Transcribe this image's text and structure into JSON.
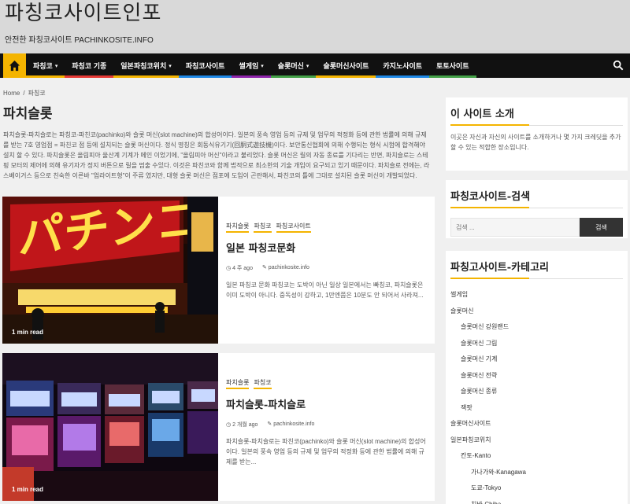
{
  "header": {
    "title": "파칭코사이트인포",
    "tagline": "안전한 파칭코사이트 PACHINKOSITE.INFO"
  },
  "nav": {
    "items": [
      {
        "label": "파칭코",
        "has_sub": true,
        "color": "#f4b400"
      },
      {
        "label": "파칭코 기종",
        "has_sub": false,
        "color": "#e53935"
      },
      {
        "label": "일본파칭코위치",
        "has_sub": true,
        "color": "#f4b400"
      },
      {
        "label": "파칭코사이트",
        "has_sub": false,
        "color": "#1e88e5"
      },
      {
        "label": "썰게임",
        "has_sub": true,
        "color": "#8e24aa"
      },
      {
        "label": "슬롯머신",
        "has_sub": true,
        "color": "#43a047"
      },
      {
        "label": "슬롯머신사이트",
        "has_sub": false,
        "color": "#f4b400"
      },
      {
        "label": "카지노사이트",
        "has_sub": false,
        "color": "#1e88e5"
      },
      {
        "label": "토토사이트",
        "has_sub": false,
        "color": "#43a047"
      }
    ],
    "home_icon": "home-icon",
    "search_icon": "search-icon"
  },
  "breadcrumb": [
    "Home",
    "파칭코"
  ],
  "page": {
    "title": "파치슬롯",
    "description": "파치슬롯-파치슬로는 파칭코-파친코(pachinko)와 슬롯 머신(slot machine)의 합성어이다. 일본의 풍속 영업 등의 규제 및 업무의 적정화 등에 관한 법률에 의해 규제를 받는 7호 영업점 = 파친코 점 등에 설치되는 슬롯 머신이다. 정식 명칭은 회동식유기기(回胴式遊技機)이다. 보안통신협회에 의해 수행되는 형식 시험에 합격해야 설치 할 수 있다. 파치슬롯은 올림피아 울산계 기계가 메인 이었기에, \"올림피아 머신\"이라고 불리었다. 슬롯 머신은 릴의 자동 종료를 기다리는 반면, 파치슬로는 스테핑 모터의 제어에 의해 유기자가 정지 버튼으로 릴을 멈출 수있다. 이것은 파친코와 함께 법적으로 최소한의 기술 개입이 요구되고 있기 때문이다. 파치슬로 전에는, 라스베이거스 등으로 친숙한 이른바 \"업라이트형\"이 주류 였지만, 대형 슬롯 머신은 점포에 도입이 곤란해서, 파친코의 틀에 그대로 설치된 슬롯 머신이 개발되었다."
  },
  "posts": [
    {
      "read_time": "1 min read",
      "categories": [
        "파치슬롯",
        "파칭코",
        "파칭코사이트"
      ],
      "title": "일본 파칭코문화",
      "date": "4 주 ago",
      "author": "pachinkosite.info",
      "excerpt": "일본 파칭코 문화 파칭코는 도박이 아닌 일상 일본에서는 빠칭코, 파치슬롯은 이미 도박이 아니다. 중독성이 강하고, 1만엔쯤은 10분도 안 되어서 사라져..."
    },
    {
      "read_time": "1 min read",
      "categories": [
        "파치슬롯",
        "파칭코"
      ],
      "title": "파치슬롯-파치슬로",
      "date": "2 개월 ago",
      "author": "pachinkosite.info",
      "excerpt": "파치슬롯-파치슬로는 파친코(pachinko)와 슬롯 머신(slot machine)의 합성어이다. 일본의 풍속 영업 등의 규제 및 업무의 적정화 등에 관한 법률에 의해 규제를 받는..."
    }
  ],
  "sidebar": {
    "about": {
      "title": "이 사이트 소개",
      "text": "이곳은 자신과 자신의 사이트를 소개하거나 몇 가지 크레딧을 추가할 수 있는 적합한 장소입니다."
    },
    "search": {
      "title": "파칭코사이트-검색",
      "placeholder": "검색 ...",
      "button": "검색"
    },
    "categories": {
      "title": "파칭고사이트-카테고리",
      "items": [
        {
          "label": "썰게임",
          "level": 1
        },
        {
          "label": "슬롯머신",
          "level": 1
        },
        {
          "label": "슬롯머신 강원랜드",
          "level": 2
        },
        {
          "label": "슬롯머신 그림",
          "level": 2
        },
        {
          "label": "슬롯머신 기계",
          "level": 2
        },
        {
          "label": "슬롯머신 전략",
          "level": 2
        },
        {
          "label": "슬롯머신 종류",
          "level": 2
        },
        {
          "label": "잭팟",
          "level": 2
        },
        {
          "label": "슬롯머신사이트",
          "level": 1
        },
        {
          "label": "일본파칭코위치",
          "level": 1
        },
        {
          "label": "칸토-Kanto",
          "level": 2
        },
        {
          "label": "가나가와-Kanagawa",
          "level": 3
        },
        {
          "label": "도쿄-Tokyo",
          "level": 3
        },
        {
          "label": "치바-Chiba",
          "level": 3
        }
      ]
    }
  }
}
